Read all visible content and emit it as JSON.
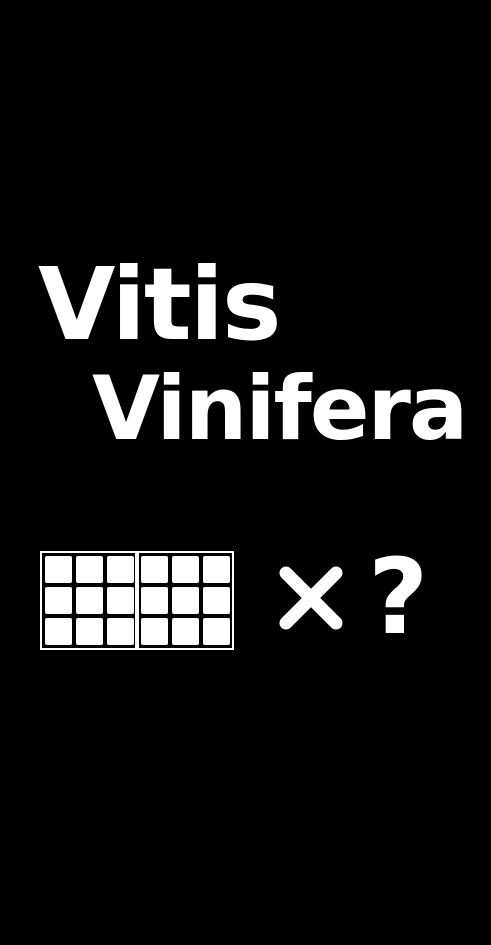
{
  "title": {
    "line1": "Vitis",
    "line2": "Vinifera"
  },
  "puzzle": {
    "grid_icon": "two-three-by-three-grids-icon",
    "operator": "×",
    "operator_icon": "times-icon",
    "unknown": "?"
  },
  "colors": {
    "background": "#000000",
    "foreground": "#ffffff"
  }
}
